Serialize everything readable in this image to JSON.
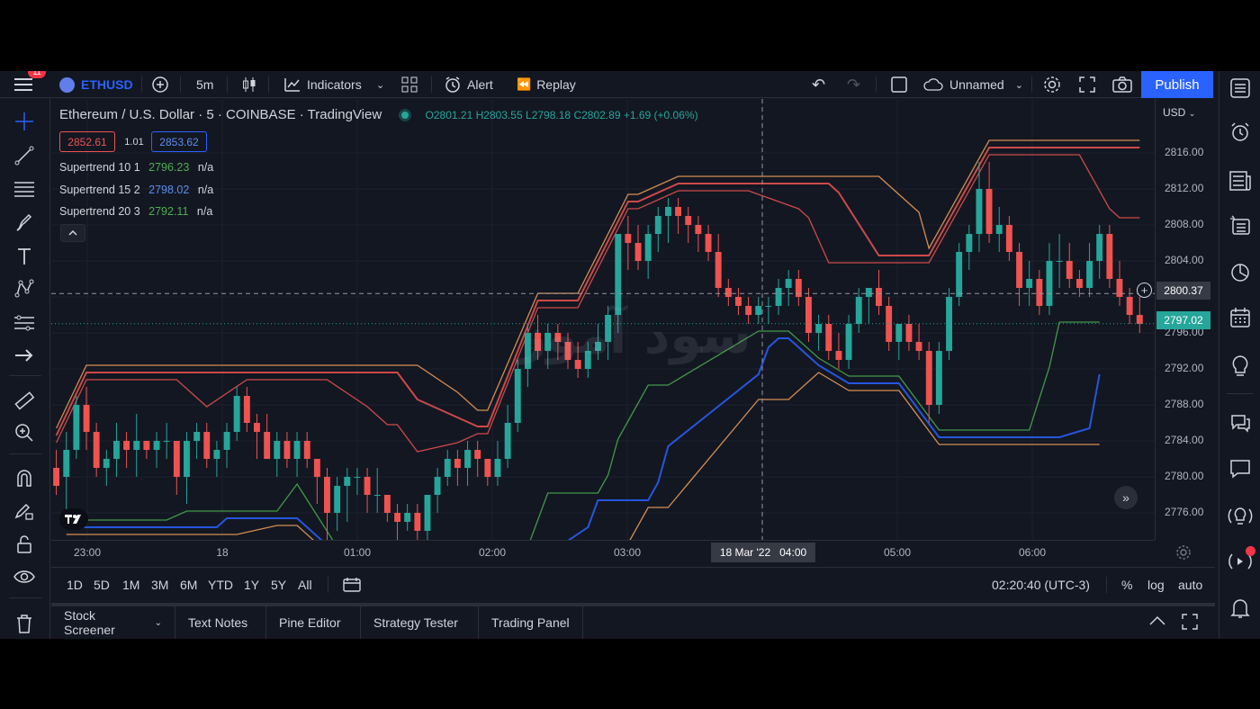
{
  "header": {
    "notification_count": "11",
    "symbol": "ETHUSD",
    "interval": "5m",
    "indicators_label": "Indicators",
    "alert_label": "Alert",
    "replay_label": "Replay",
    "layout_name": "Unnamed",
    "publish_label": "Publish"
  },
  "legend": {
    "title": "Ethereum / U.S. Dollar · 5 · COINBASE · TradingView",
    "open_key": "O",
    "open": "2801.21",
    "high_key": "H",
    "high": "2803.55",
    "low_key": "L",
    "low": "2798.18",
    "close_key": "C",
    "close": "2802.89",
    "change": "+1.69 (+0.06%)",
    "sell_price": "2852.61",
    "spread": "1.01",
    "buy_price": "2853.62"
  },
  "indicators": [
    {
      "label": "Supertrend 10 1",
      "value": "2796.23",
      "extra": "n/a"
    },
    {
      "label": "Supertrend 15 2",
      "value": "2798.02",
      "extra": "n/a"
    },
    {
      "label": "Supertrend 20 3",
      "value": "2792.11",
      "extra": "n/a"
    }
  ],
  "price_axis": {
    "currency": "USD",
    "ticks": [
      "2816.00",
      "2812.00",
      "2808.00",
      "2804.00",
      "2800.00",
      "2796.00",
      "2792.00",
      "2788.00",
      "2784.00",
      "2780.00",
      "2776.00"
    ],
    "crosshair_label": "2800.37",
    "last_price_label": "2797.02"
  },
  "time_axis": {
    "ticks": [
      "23:00",
      "18",
      "01:00",
      "02:00",
      "03:00",
      "05:00",
      "06:00"
    ],
    "crosshair_label": "18 Mar '22   04:00"
  },
  "ranges": [
    "1D",
    "5D",
    "1M",
    "3M",
    "6M",
    "YTD",
    "1Y",
    "5Y",
    "All"
  ],
  "status": {
    "clock": "02:20:40 (UTC-3)",
    "percent": "%",
    "log": "log",
    "auto": "auto"
  },
  "panel_tabs": [
    "Stock Screener",
    "Text Notes",
    "Pine Editor",
    "Strategy Tester",
    "Trading Panel"
  ],
  "watermark": "سود آموز",
  "colors": {
    "background": "#131722",
    "bull": "#26a69a",
    "bear": "#ef5350",
    "accent": "#2962ff",
    "supertrend_orange": "#f7a35c",
    "supertrend_green": "#4caf50",
    "supertrend_blue": "#2962ff"
  },
  "chart_data": {
    "type": "candlestick",
    "symbol": "ETHUSD",
    "interval": "5m",
    "ylim": [
      2773,
      2822
    ],
    "candles": [
      [
        2781,
        2783,
        2778,
        2779
      ],
      [
        2780,
        2785,
        2776,
        2783
      ],
      [
        2783,
        2789,
        2782,
        2788
      ],
      [
        2788,
        2790,
        2783,
        2785
      ],
      [
        2785,
        2786,
        2780,
        2781
      ],
      [
        2781,
        2783,
        2779,
        2782
      ],
      [
        2782,
        2786,
        2780,
        2784
      ],
      [
        2784,
        2785,
        2781,
        2783
      ],
      [
        2783,
        2787,
        2780,
        2784
      ],
      [
        2784,
        2784,
        2782,
        2783
      ],
      [
        2783,
        2785,
        2781,
        2784
      ],
      [
        2784,
        2786,
        2782,
        2784
      ],
      [
        2784,
        2784,
        2778,
        2780
      ],
      [
        2780,
        2785,
        2777,
        2784
      ],
      [
        2784,
        2786,
        2782,
        2785
      ],
      [
        2785,
        2786,
        2781,
        2782
      ],
      [
        2782,
        2784,
        2780,
        2783
      ],
      [
        2783,
        2786,
        2781,
        2785
      ],
      [
        2785,
        2790,
        2784,
        2789
      ],
      [
        2789,
        2790,
        2785,
        2786
      ],
      [
        2786,
        2787,
        2782,
        2785
      ],
      [
        2785,
        2787,
        2782,
        2782
      ],
      [
        2782,
        2785,
        2780,
        2784
      ],
      [
        2784,
        2785,
        2781,
        2782
      ],
      [
        2782,
        2785,
        2780,
        2784
      ],
      [
        2784,
        2785,
        2781,
        2782
      ],
      [
        2782,
        2782,
        2777,
        2780
      ],
      [
        2780,
        2781,
        2773,
        2776
      ],
      [
        2776,
        2780,
        2774,
        2779
      ],
      [
        2779,
        2781,
        2775,
        2780
      ],
      [
        2780,
        2781,
        2778,
        2780
      ],
      [
        2780,
        2781,
        2776,
        2778
      ],
      [
        2778,
        2781,
        2776,
        2778
      ],
      [
        2778,
        2778,
        2775,
        2776
      ],
      [
        2776,
        2777,
        2773,
        2775
      ],
      [
        2775,
        2777,
        2774,
        2776
      ],
      [
        2776,
        2777,
        2773,
        2774
      ],
      [
        2774,
        2778,
        2773,
        2778
      ],
      [
        2778,
        2781,
        2776,
        2780
      ],
      [
        2780,
        2783,
        2779,
        2782
      ],
      [
        2782,
        2783,
        2779,
        2781
      ],
      [
        2781,
        2784,
        2779,
        2783
      ],
      [
        2783,
        2784,
        2780,
        2782
      ],
      [
        2782,
        2782,
        2779,
        2780
      ],
      [
        2780,
        2784,
        2779,
        2782
      ],
      [
        2782,
        2788,
        2781,
        2786
      ],
      [
        2786,
        2793,
        2785,
        2792
      ],
      [
        2792,
        2797,
        2790,
        2796
      ],
      [
        2796,
        2798,
        2793,
        2794
      ],
      [
        2794,
        2797,
        2792,
        2796
      ],
      [
        2796,
        2797,
        2793,
        2795
      ],
      [
        2795,
        2796,
        2792,
        2793
      ],
      [
        2793,
        2795,
        2791,
        2792
      ],
      [
        2792,
        2795,
        2791,
        2794
      ],
      [
        2794,
        2797,
        2793,
        2795
      ],
      [
        2795,
        2799,
        2793,
        2798
      ],
      [
        2798,
        2806,
        2796,
        2807
      ],
      [
        2807,
        2809,
        2803,
        2806
      ],
      [
        2806,
        2808,
        2803,
        2804
      ],
      [
        2804,
        2808,
        2802,
        2807
      ],
      [
        2807,
        2810,
        2805,
        2809
      ],
      [
        2809,
        2811,
        2806,
        2810
      ],
      [
        2810,
        2811,
        2807,
        2809
      ],
      [
        2809,
        2810,
        2806,
        2808
      ],
      [
        2808,
        2809,
        2805,
        2807
      ],
      [
        2807,
        2808,
        2804,
        2805
      ],
      [
        2805,
        2807,
        2800,
        2801
      ],
      [
        2801,
        2802,
        2799,
        2800
      ],
      [
        2800,
        2801,
        2798,
        2799
      ],
      [
        2799,
        2800,
        2797,
        2798
      ],
      [
        2798,
        2800,
        2797,
        2799
      ],
      [
        2799,
        2800,
        2797,
        2799
      ],
      [
        2799,
        2802,
        2798,
        2801
      ],
      [
        2801,
        2803,
        2799,
        2802
      ],
      [
        2802,
        2803,
        2799,
        2800
      ],
      [
        2800,
        2801,
        2795,
        2796
      ],
      [
        2796,
        2798,
        2794,
        2797
      ],
      [
        2797,
        2798,
        2793,
        2794
      ],
      [
        2794,
        2796,
        2792,
        2793
      ],
      [
        2793,
        2798,
        2792,
        2797
      ],
      [
        2797,
        2801,
        2796,
        2800
      ],
      [
        2800,
        2801,
        2797,
        2801
      ],
      [
        2801,
        2803,
        2798,
        2799
      ],
      [
        2799,
        2800,
        2794,
        2795
      ],
      [
        2795,
        2797,
        2793,
        2797
      ],
      [
        2797,
        2798,
        2794,
        2795
      ],
      [
        2795,
        2797,
        2793,
        2794
      ],
      [
        2794,
        2795,
        2786,
        2788
      ],
      [
        2788,
        2795,
        2787,
        2794
      ],
      [
        2794,
        2801,
        2793,
        2800
      ],
      [
        2800,
        2806,
        2799,
        2805
      ],
      [
        2805,
        2808,
        2803,
        2807
      ],
      [
        2807,
        2815,
        2805,
        2812
      ],
      [
        2812,
        2815,
        2806,
        2807
      ],
      [
        2807,
        2810,
        2805,
        2808
      ],
      [
        2808,
        2809,
        2804,
        2805
      ],
      [
        2805,
        2806,
        2799,
        2801
      ],
      [
        2801,
        2804,
        2799,
        2802
      ],
      [
        2802,
        2803,
        2798,
        2799
      ],
      [
        2799,
        2806,
        2798,
        2804
      ],
      [
        2804,
        2807,
        2801,
        2804
      ],
      [
        2804,
        2806,
        2801,
        2802
      ],
      [
        2802,
        2803,
        2800,
        2801
      ],
      [
        2801,
        2806,
        2800,
        2804
      ],
      [
        2804,
        2808,
        2802,
        2807
      ],
      [
        2807,
        2808,
        2801,
        2802
      ],
      [
        2802,
        2804,
        2799,
        2800
      ],
      [
        2800,
        2801,
        2797,
        2798
      ],
      [
        2798,
        2800,
        2796,
        2797
      ]
    ],
    "supertrends": [
      {
        "name": "Supertrend 10 1",
        "value": 2796.23
      },
      {
        "name": "Supertrend 15 2",
        "value": 2798.02
      },
      {
        "name": "Supertrend 20 3",
        "value": 2792.11
      }
    ]
  }
}
